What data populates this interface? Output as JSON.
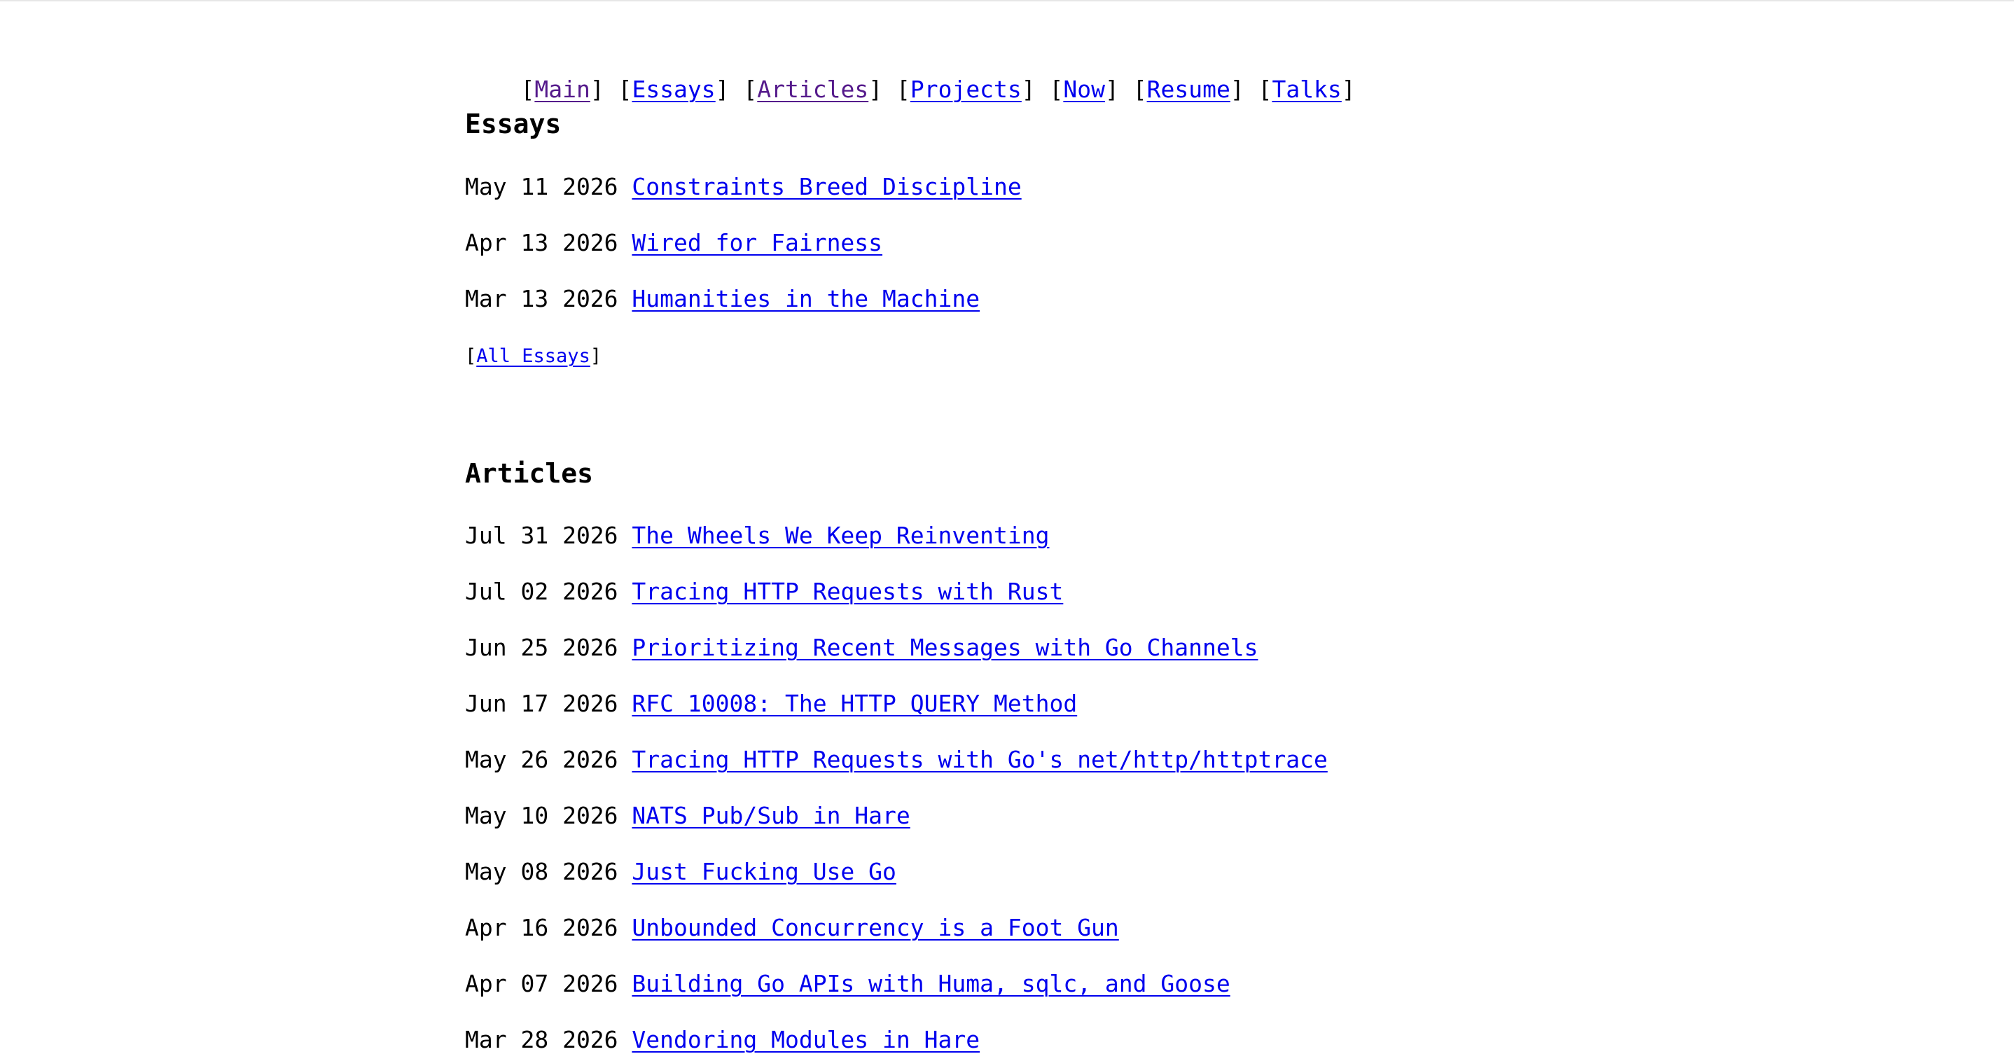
{
  "nav": {
    "items": [
      {
        "label": "Main",
        "visited": true
      },
      {
        "label": "Essays",
        "visited": false
      },
      {
        "label": "Articles",
        "visited": true
      },
      {
        "label": "Projects",
        "visited": false
      },
      {
        "label": "Now",
        "visited": false
      },
      {
        "label": "Resume",
        "visited": false
      },
      {
        "label": "Talks",
        "visited": false
      }
    ]
  },
  "essays": {
    "title": "Essays",
    "items": [
      {
        "date": "May 11 2026",
        "title": "Constraints Breed Discipline"
      },
      {
        "date": "Apr 13 2026",
        "title": "Wired for Fairness"
      },
      {
        "date": "Mar 13 2026",
        "title": "Humanities in the Machine"
      }
    ],
    "all_label": "All Essays"
  },
  "articles": {
    "title": "Articles",
    "items": [
      {
        "date": "Jul 31 2026",
        "title": "The Wheels We Keep Reinventing"
      },
      {
        "date": "Jul 02 2026",
        "title": "Tracing HTTP Requests with Rust"
      },
      {
        "date": "Jun 25 2026",
        "title": "Prioritizing Recent Messages with Go Channels"
      },
      {
        "date": "Jun 17 2026",
        "title": "RFC 10008: The HTTP QUERY Method"
      },
      {
        "date": "May 26 2026",
        "title": "Tracing HTTP Requests with Go's net/http/httptrace"
      },
      {
        "date": "May 10 2026",
        "title": "NATS Pub/Sub in Hare"
      },
      {
        "date": "May 08 2026",
        "title": "Just Fucking Use Go"
      },
      {
        "date": "Apr 16 2026",
        "title": "Unbounded Concurrency is a Foot Gun"
      },
      {
        "date": "Apr 07 2026",
        "title": "Building Go APIs with Huma, sqlc, and Goose"
      },
      {
        "date": "Mar 28 2026",
        "title": "Vendoring Modules in Hare"
      }
    ]
  },
  "colors": {
    "link": "#0000ee",
    "visited_link": "#551a8b",
    "text": "#000000",
    "background": "#ffffff"
  }
}
